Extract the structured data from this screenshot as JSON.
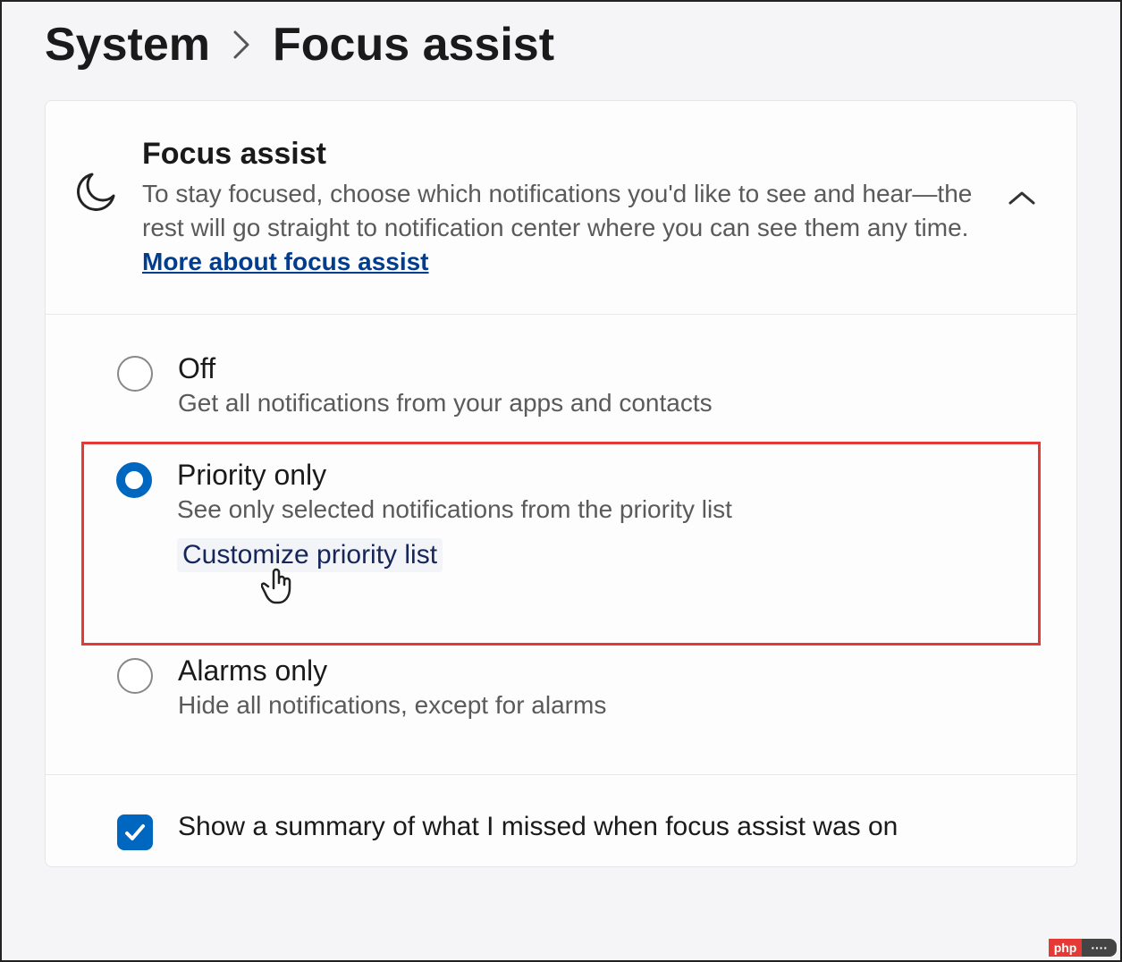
{
  "breadcrumb": {
    "parent": "System",
    "current": "Focus assist"
  },
  "header": {
    "title": "Focus assist",
    "desc_pre": "To stay focused, choose which notifications you'd like to see and hear—the rest will go straight to notification center where you can see them any time.  ",
    "more_link": "More about focus assist"
  },
  "options": {
    "off": {
      "label": "Off",
      "desc": "Get all notifications from your apps and contacts"
    },
    "priority": {
      "label": "Priority only",
      "desc": "See only selected notifications from the priority list",
      "customize": "Customize priority list"
    },
    "alarms": {
      "label": "Alarms only",
      "desc": "Hide all notifications, except for alarms"
    }
  },
  "summary": {
    "label": "Show a summary of what I missed when focus assist was on"
  },
  "watermark": {
    "a": "php",
    "b": "····"
  }
}
